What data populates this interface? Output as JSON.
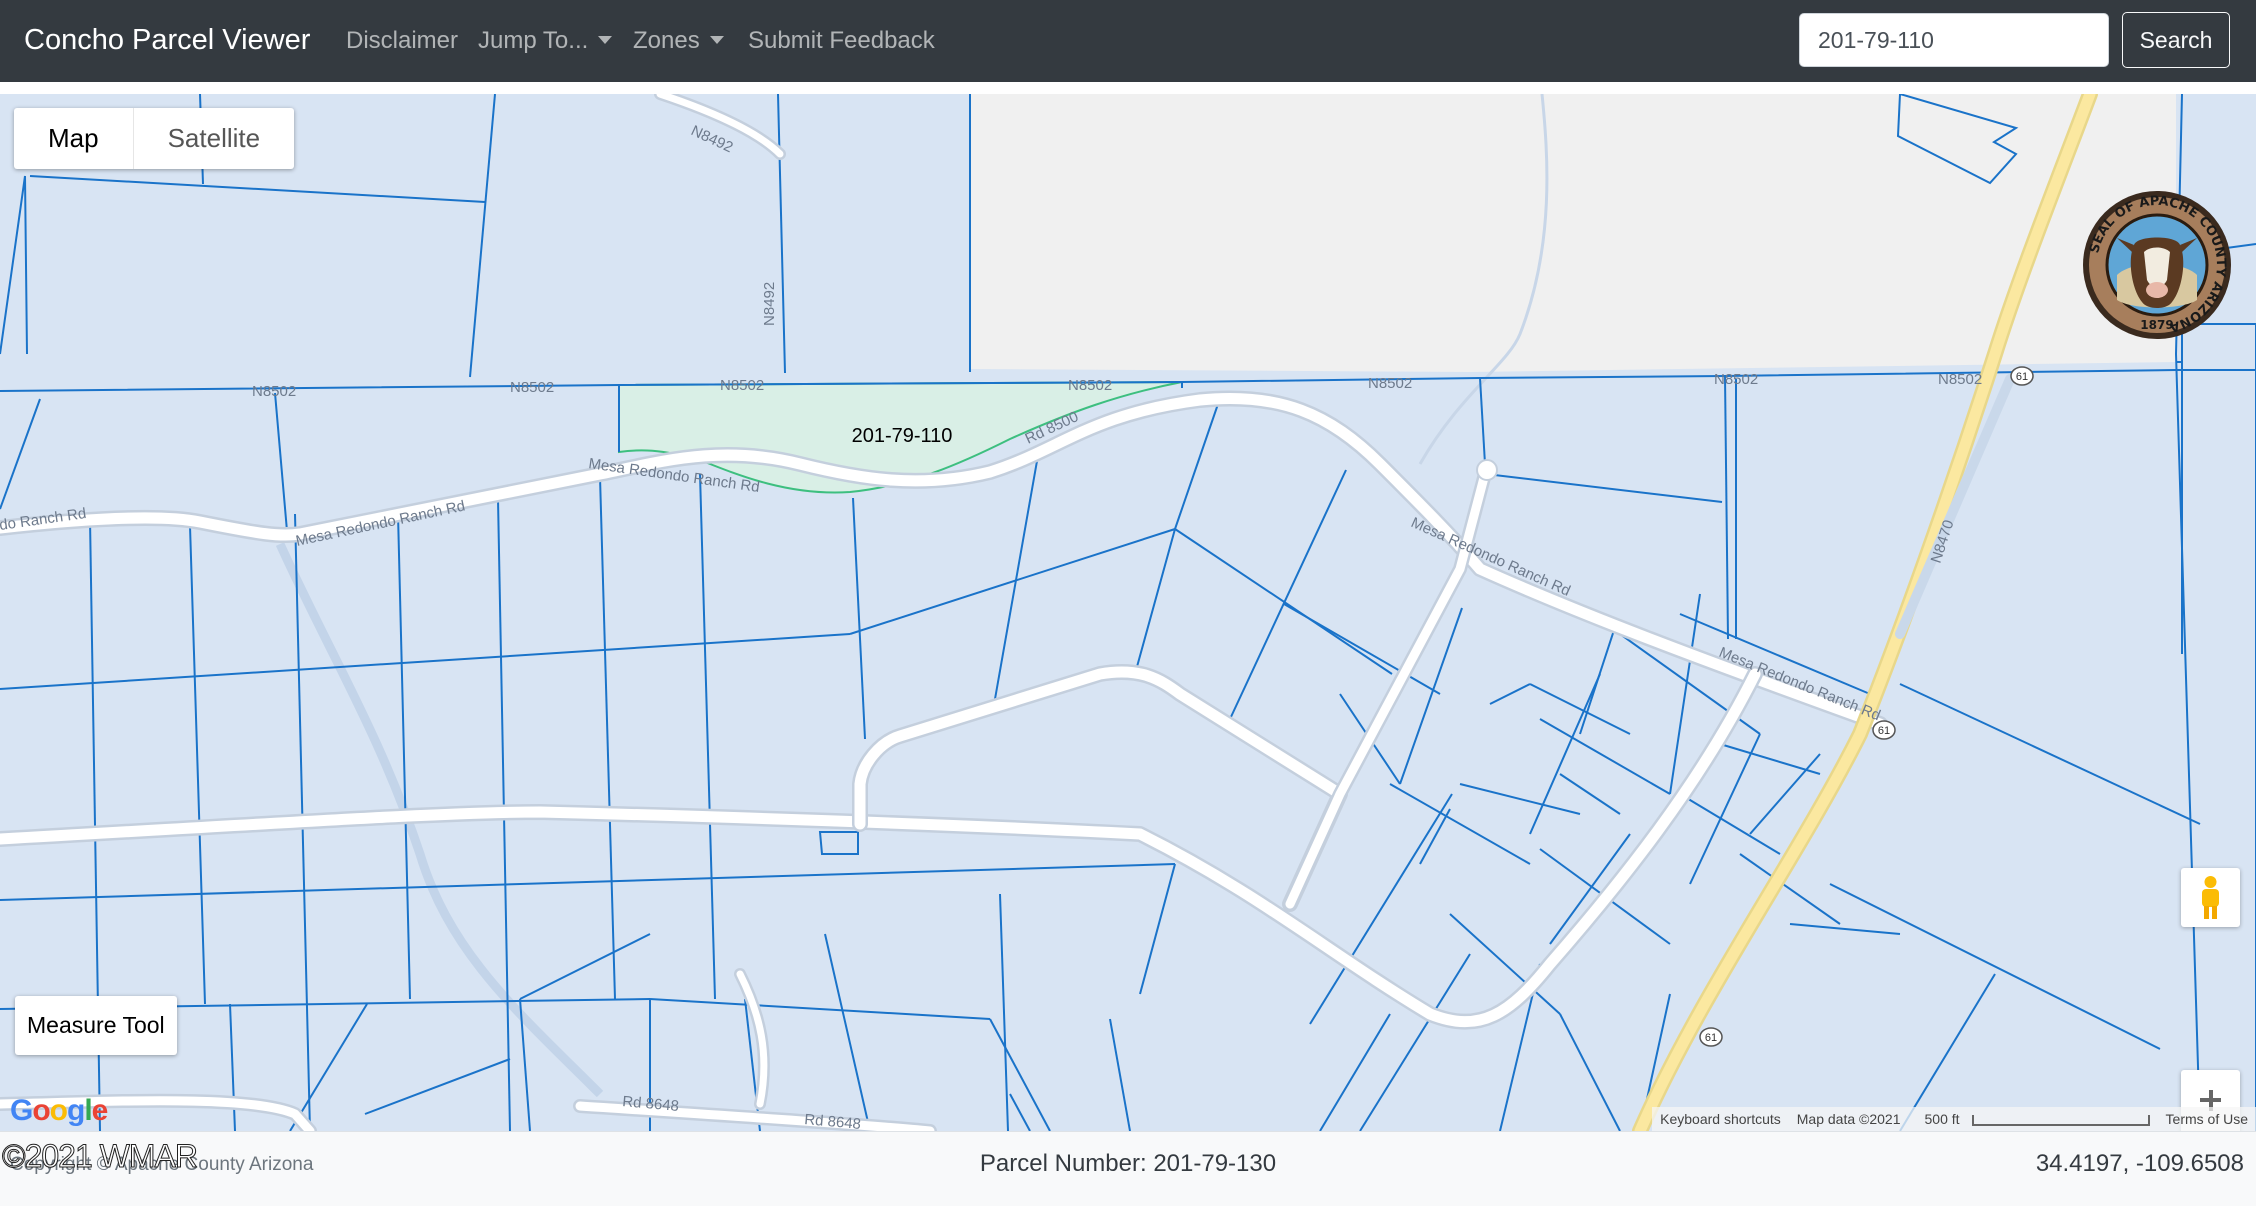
{
  "navbar": {
    "brand": "Concho Parcel Viewer",
    "links": [
      "Disclaimer",
      "Jump To...",
      "Zones",
      "Submit Feedback"
    ],
    "search_value": "201-79-110",
    "search_button": "Search"
  },
  "map": {
    "type_control": {
      "map": "Map",
      "satellite": "Satellite",
      "selected": "Map"
    },
    "selected_parcel_label": "201-79-110",
    "road_labels": [
      "N8492",
      "N8492",
      "N8502",
      "N8502",
      "N8502",
      "N8502",
      "N8502",
      "N8502",
      "N8502",
      "Mesa Redondo Ranch Rd",
      "Mesa Redondo Ranch Rd",
      "Mesa Redondo Ranch Rd",
      "do Ranch Rd",
      "Mesa Redondo Ranch Rd",
      "Rd 8500",
      "N8470",
      "Rd 8648",
      "Rd 8648"
    ],
    "highway_shields": [
      "61",
      "61",
      "61"
    ],
    "measure_tool": "Measure Tool",
    "google_logo": "Google",
    "attribution": {
      "keyboard": "Keyboard shortcuts",
      "map_data": "Map data ©2021",
      "scale": "500 ft",
      "terms": "Terms of Use"
    },
    "seal_text": "SEAL OF APACHE COUNTY ARIZONA",
    "seal_year": "1879",
    "colors": {
      "parcel_fill": "#d8e4f3",
      "parcel_line": "#1a73c9",
      "selected_fill": "#d9efe6",
      "selected_line": "#3dbf7f",
      "highway": "#fbe8a0"
    }
  },
  "footer": {
    "copyright": "Copyright © Apache County Arizona",
    "parcel_number": "Parcel Number: 201-79-130",
    "coordinates": "34.4197, -109.6508",
    "watermark": "©2021 WMAR"
  }
}
